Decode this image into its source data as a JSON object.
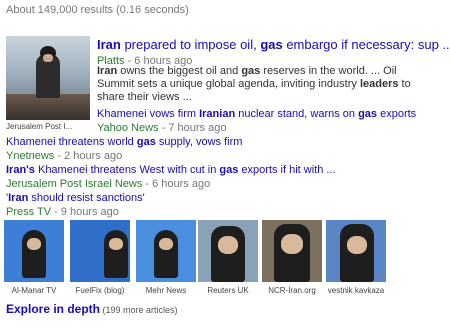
{
  "stats": "About 149,000 results (0.16 seconds)",
  "lead": {
    "title_pre": "Iran",
    "title_mid1": " prepared to impose oil, ",
    "title_gas": "gas",
    "title_post": " embargo if necessary: sup ...",
    "source": "Platts",
    "age": " - 6 hours ago",
    "snippet_1": "Iran",
    "snippet_2": " owns the biggest oil and ",
    "snippet_3": "gas",
    "snippet_4": " reserves in the world. ... Oil Summit sets a unique global agenda, inviting industry ",
    "snippet_5": "leaders",
    "snippet_6": " to share their views ...",
    "thumb_caption": "Jerusalem Post I..."
  },
  "related": [
    {
      "t1": "Khamenei vows firm ",
      "t2": "Iranian",
      "t3": " nuclear stand, warns on ",
      "t4": "gas",
      "t5": " exports",
      "source": "Yahoo News",
      "age": " - 7 hours ago"
    },
    {
      "t1": "Khamenei threatens world ",
      "t2": "gas",
      "t3": " supply, vows firm",
      "t4": "",
      "t5": "",
      "source": "Ynetnews",
      "age": " - 2 hours ago"
    },
    {
      "t1": "",
      "t2": "Iran's",
      "t3": " Khamenei threatens West with cut in ",
      "t4": "gas",
      "t5": " exports if hit with ...",
      "source": "Jerusalem Post Israel News",
      "age": " - 6 hours ago"
    },
    {
      "t1": "'",
      "t2": "Iran",
      "t3": " should resist sanctions'",
      "t4": "",
      "t5": "",
      "source": "Press TV",
      "age": " - 9 hours ago"
    }
  ],
  "images": [
    {
      "caption": "Al-Manar TV",
      "bg": "#3d7fd6"
    },
    {
      "caption": "FuelFix (blog)",
      "bg": "#2f6ec9"
    },
    {
      "caption": "Mehr News",
      "bg": "#4a8ee0"
    },
    {
      "caption": "Reuters UK",
      "bg": "#8aa2b8"
    },
    {
      "caption": "NCR-Iran.org",
      "bg": "#7d7060"
    },
    {
      "caption": "vestnik kavkaza",
      "bg": "#5a86c6"
    }
  ],
  "explore": {
    "label": "Explore in depth",
    "more": " (199 more articles)"
  }
}
